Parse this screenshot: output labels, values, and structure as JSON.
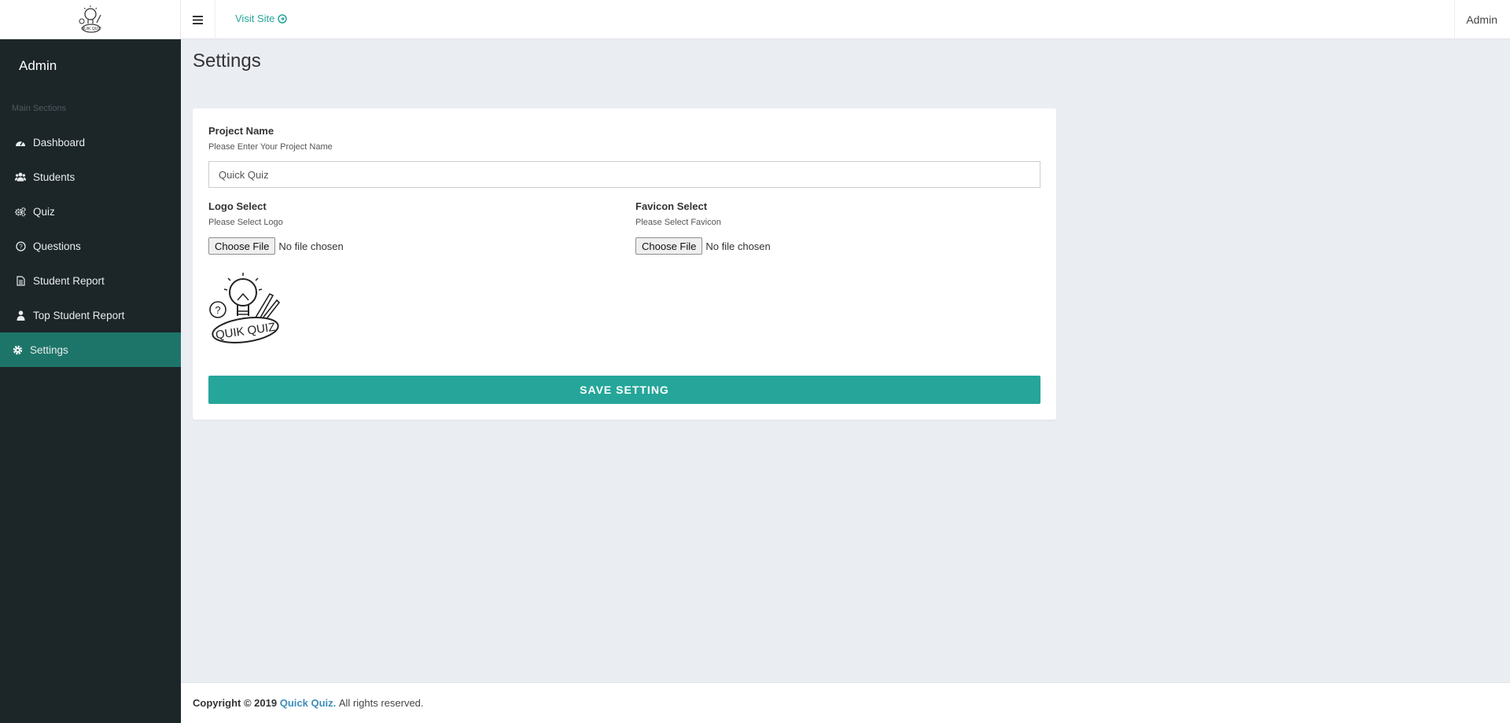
{
  "topbar": {
    "visit_site": "Visit Site",
    "user": "Admin"
  },
  "sidebar": {
    "title": "Admin",
    "section": "Main Sections",
    "items": [
      {
        "label": "Dashboard",
        "icon": "dashboard-icon"
      },
      {
        "label": "Students",
        "icon": "users-icon"
      },
      {
        "label": "Quiz",
        "icon": "gears-icon"
      },
      {
        "label": "Questions",
        "icon": "question-circle-icon"
      },
      {
        "label": "Student Report",
        "icon": "file-text-icon"
      },
      {
        "label": "Top Student Report",
        "icon": "user-icon"
      },
      {
        "label": "Settings",
        "icon": "gear-icon",
        "active": true
      }
    ]
  },
  "page": {
    "title": "Settings"
  },
  "form": {
    "project_name_label": "Project Name",
    "project_name_help": "Please Enter Your Project Name",
    "project_name_value": "Quick Quiz",
    "logo_label": "Logo Select",
    "logo_help": "Please Select Logo",
    "favicon_label": "Favicon Select",
    "favicon_help": "Please Select Favicon",
    "choose_file": "Choose File",
    "no_file": "No file chosen",
    "logo_text": "QUIK QUIZ",
    "save_label": "SAVE SETTING"
  },
  "footer": {
    "copyright": "Copyright © 2019",
    "brand": "Quick Quiz.",
    "rights": "All rights reserved."
  },
  "colors": {
    "accent": "#26a69a",
    "sidebar_bg": "#1c2528",
    "active_item": "#1d7569",
    "link": "#3c8dbc"
  }
}
